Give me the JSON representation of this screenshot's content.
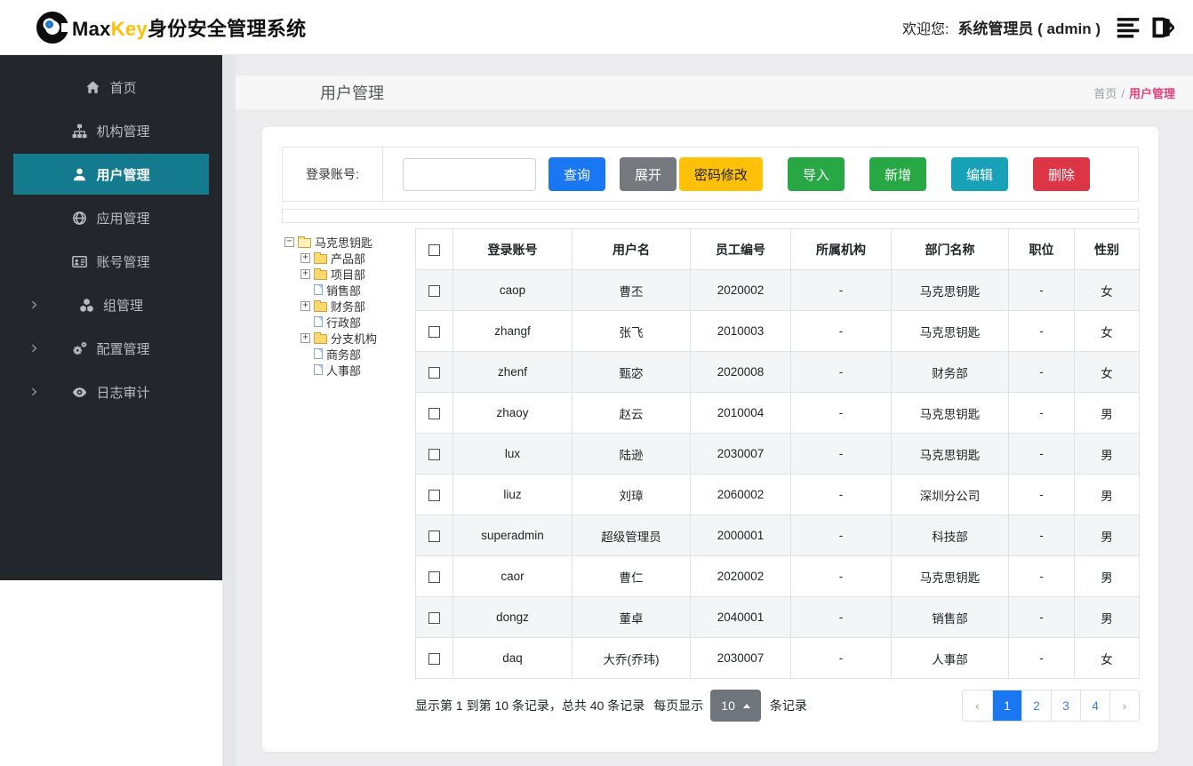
{
  "header": {
    "brand": {
      "max": "Max",
      "key": "Key",
      "suffix": "身份安全管理系统"
    },
    "welcome_label": "欢迎您:",
    "user_label": "系统管理员 ( admin )",
    "icons": [
      "menu-icon",
      "logout-icon"
    ]
  },
  "sidebar": {
    "items": [
      {
        "id": "home",
        "label": "首页",
        "icon": "home-icon",
        "active": false,
        "has_children": false
      },
      {
        "id": "org",
        "label": "机构管理",
        "icon": "sitemap-icon",
        "active": false,
        "has_children": false
      },
      {
        "id": "user",
        "label": "用户管理",
        "icon": "user-icon",
        "active": true,
        "has_children": false
      },
      {
        "id": "app",
        "label": "应用管理",
        "icon": "globe-icon",
        "active": false,
        "has_children": false
      },
      {
        "id": "account",
        "label": "账号管理",
        "icon": "id-card-icon",
        "active": false,
        "has_children": false
      },
      {
        "id": "group",
        "label": "组管理",
        "icon": "cubes-icon",
        "active": false,
        "has_children": true
      },
      {
        "id": "config",
        "label": "配置管理",
        "icon": "gears-icon",
        "active": false,
        "has_children": true
      },
      {
        "id": "audit",
        "label": "日志审计",
        "icon": "eye-icon",
        "active": false,
        "has_children": true
      }
    ]
  },
  "page": {
    "title": "用户管理",
    "breadcrumb": {
      "home": "首页",
      "sep": "/",
      "current": "用户管理"
    }
  },
  "search": {
    "label": "登录账号:",
    "input_value": "",
    "query_label": "查询",
    "expand_label": "展开"
  },
  "actions": [
    {
      "id": "change-password",
      "label": "密码修改",
      "bg": "#ffc107",
      "fg": "#212529"
    },
    {
      "id": "import",
      "label": "导入",
      "bg": "#28a745",
      "fg": "#ffffff"
    },
    {
      "id": "add",
      "label": "新增",
      "bg": "#28a745",
      "fg": "#ffffff"
    },
    {
      "id": "edit",
      "label": "编辑",
      "bg": "#17a2b8",
      "fg": "#ffffff"
    },
    {
      "id": "delete",
      "label": "删除",
      "bg": "#dc3545",
      "fg": "#ffffff"
    }
  ],
  "tree": {
    "nodes": [
      {
        "level": 0,
        "expander": "minus",
        "icon": "folder-open",
        "label": "马克思钥匙"
      },
      {
        "level": 1,
        "expander": "plus",
        "icon": "folder",
        "label": "产品部"
      },
      {
        "level": 1,
        "expander": "plus",
        "icon": "folder",
        "label": "项目部"
      },
      {
        "level": 1,
        "expander": "none",
        "icon": "file",
        "label": "销售部"
      },
      {
        "level": 1,
        "expander": "plus",
        "icon": "folder",
        "label": "财务部"
      },
      {
        "level": 1,
        "expander": "none",
        "icon": "file",
        "label": "行政部"
      },
      {
        "level": 1,
        "expander": "plus",
        "icon": "folder",
        "label": "分支机构"
      },
      {
        "level": 1,
        "expander": "none",
        "icon": "file",
        "label": "商务部"
      },
      {
        "level": 1,
        "expander": "none",
        "icon": "file",
        "label": "人事部"
      }
    ]
  },
  "table": {
    "headers": [
      "登录账号",
      "用户名",
      "员工编号",
      "所属机构",
      "部门名称",
      "职位",
      "性别"
    ],
    "rows": [
      [
        "caop",
        "曹丕",
        "2020002",
        "-",
        "马克思钥匙",
        "-",
        "女"
      ],
      [
        "zhangf",
        "张飞",
        "2010003",
        "-",
        "马克思钥匙",
        "-",
        "女"
      ],
      [
        "zhenf",
        "甄宓",
        "2020008",
        "-",
        "财务部",
        "-",
        "女"
      ],
      [
        "zhaoy",
        "赵云",
        "2010004",
        "-",
        "马克思钥匙",
        "-",
        "男"
      ],
      [
        "lux",
        "陆逊",
        "2030007",
        "-",
        "马克思钥匙",
        "-",
        "男"
      ],
      [
        "liuz",
        "刘璋",
        "2060002",
        "-",
        "深圳分公司",
        "-",
        "男"
      ],
      [
        "superadmin",
        "超级管理员",
        "2000001",
        "-",
        "科技部",
        "-",
        "男"
      ],
      [
        "caor",
        "曹仁",
        "2020002",
        "-",
        "马克思钥匙",
        "-",
        "男"
      ],
      [
        "dongz",
        "董卓",
        "2040001",
        "-",
        "销售部",
        "-",
        "男"
      ],
      [
        "daq",
        "大乔(乔玮)",
        "2030007",
        "-",
        "人事部",
        "-",
        "女"
      ]
    ]
  },
  "pagination": {
    "info": "显示第 1 到第 10 条记录，总共 40 条记录",
    "per_page_prefix": "每页显示",
    "per_page_value": "10",
    "per_page_suffix": "条记录",
    "pages": [
      "‹",
      "1",
      "2",
      "3",
      "4",
      "›"
    ],
    "active_page": "1"
  },
  "colors": {
    "sidebar_bg": "#23272b",
    "sidebar_active": "#147a8e",
    "primary_blue": "#1a77f2",
    "expand_gray": "#75797e",
    "warning_yellow": "#ffc107",
    "success_green": "#28a745",
    "info_teal": "#17a2b8",
    "danger_red": "#dc3545",
    "breadcrumb_pink": "#e8417c",
    "brand_key_yellow": "#ffc107"
  }
}
